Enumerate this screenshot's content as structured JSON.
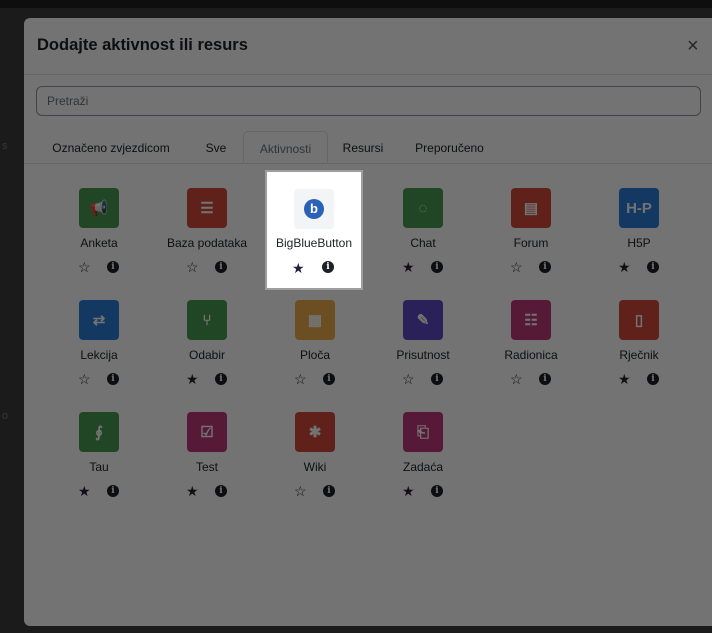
{
  "modal": {
    "title": "Dodajte aktivnost ili resurs",
    "close_glyph": "×"
  },
  "search": {
    "placeholder": "Pretraži"
  },
  "tabs": [
    {
      "label": "Označeno zvjezdicom",
      "active": false
    },
    {
      "label": "Sve",
      "active": false
    },
    {
      "label": "Aktivnosti",
      "active": true
    },
    {
      "label": "Resursi",
      "active": false
    },
    {
      "label": "Preporučeno",
      "active": false
    }
  ],
  "activities": [
    {
      "label": "Anketa",
      "favourite": false,
      "icon": "megaphone-icon",
      "color": "#4a9c52"
    },
    {
      "label": "Baza podataka",
      "favourite": false,
      "icon": "database-icon",
      "color": "#d2493b"
    },
    {
      "label": "BigBlueButton",
      "favourite": true,
      "icon": "bigbluebutton-icon",
      "color": "#2962b7"
    },
    {
      "label": "Chat",
      "favourite": true,
      "icon": "chat-icon",
      "color": "#4a9c52"
    },
    {
      "label": "Forum",
      "favourite": false,
      "icon": "forum-icon",
      "color": "#d2493b"
    },
    {
      "label": "H5P",
      "favourite": true,
      "icon": "h5p-icon",
      "color": "#2a7dd9"
    },
    {
      "label": "Lekcija",
      "favourite": false,
      "icon": "lesson-icon",
      "color": "#2a7dd9"
    },
    {
      "label": "Odabir",
      "favourite": true,
      "icon": "choice-icon",
      "color": "#4a9c52"
    },
    {
      "label": "Ploča",
      "favourite": false,
      "icon": "board-icon",
      "color": "#f0ad4e"
    },
    {
      "label": "Prisutnost",
      "favourite": false,
      "icon": "attendance-icon",
      "color": "#5b4bc4"
    },
    {
      "label": "Radionica",
      "favourite": false,
      "icon": "workshop-icon",
      "color": "#c2387d"
    },
    {
      "label": "Rječnik",
      "favourite": true,
      "icon": "glossary-icon",
      "color": "#d2493b"
    },
    {
      "label": "Tau",
      "favourite": true,
      "icon": "tau-icon",
      "color": "#4a9c52"
    },
    {
      "label": "Test",
      "favourite": true,
      "icon": "quiz-icon",
      "color": "#c2387d"
    },
    {
      "label": "Wiki",
      "favourite": false,
      "icon": "wiki-icon",
      "color": "#d2493b"
    },
    {
      "label": "Zadaća",
      "favourite": true,
      "icon": "assignment-icon",
      "color": "#c2387d"
    }
  ],
  "glyphs": {
    "star_empty": "☆",
    "star_full": "★",
    "info": "i"
  },
  "icon_glyphs": {
    "megaphone-icon": "📢",
    "database-icon": "☰",
    "chat-icon": "◌",
    "forum-icon": "▤",
    "h5p-icon": "H-P",
    "lesson-icon": "⇄",
    "choice-icon": "⑂",
    "board-icon": "▦",
    "attendance-icon": "✎",
    "workshop-icon": "☷",
    "glossary-icon": "▯",
    "tau-icon": "∮",
    "quiz-icon": "☑",
    "wiki-icon": "✱",
    "assignment-icon": "⎗"
  }
}
